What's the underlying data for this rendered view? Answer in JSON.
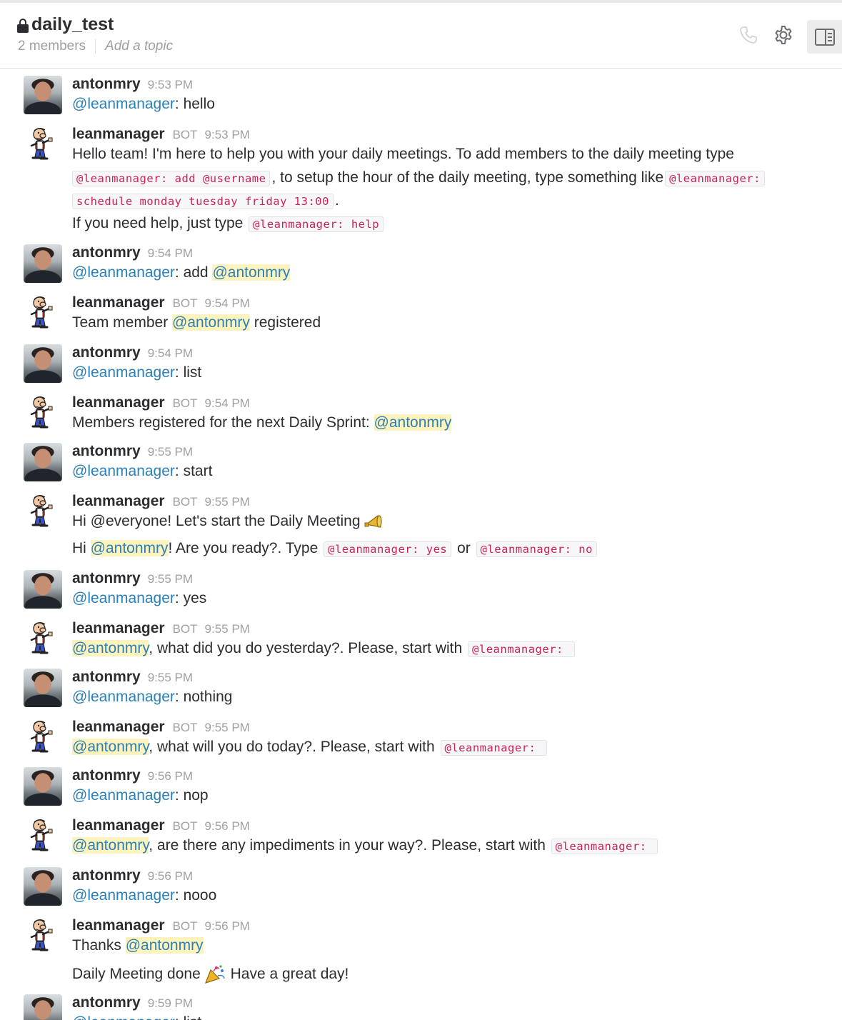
{
  "channel": {
    "name": "daily_test",
    "members": "2 members",
    "topic_placeholder": "Add a topic"
  },
  "header_icons": [
    "phone-icon",
    "gear-icon",
    "sidebar-toggle-icon"
  ],
  "bot_badge": "BOT",
  "messages": [
    {
      "user": "antonmry",
      "time": "9:53 PM",
      "mention": "@leanmanager",
      "text": ": hello"
    },
    {
      "user": "leanmanager",
      "time": "9:53 PM",
      "l1": "Hello team! I'm here to help you with your daily meetings. To add members to the daily meeting type",
      "c1": "@leanmanager: add @username",
      "l2": ", to setup the hour of the daily meeting, type something like",
      "c2a": "@leanmanager:",
      "c2b": "schedule monday tuesday friday 13:00",
      "dot": ".",
      "l3": "If you need help, just type",
      "c3": "@leanmanager: help"
    },
    {
      "user": "antonmry",
      "time": "9:54 PM",
      "mention": "@leanmanager",
      "text": ": add ",
      "mention2": "@antonmry"
    },
    {
      "user": "leanmanager",
      "time": "9:54 PM",
      "pre": "Team member ",
      "mention": "@antonmry",
      "post": " registered"
    },
    {
      "user": "antonmry",
      "time": "9:54 PM",
      "mention": "@leanmanager",
      "text": ": list"
    },
    {
      "user": "leanmanager",
      "time": "9:54 PM",
      "pre": "Members registered for the next Daily Sprint: ",
      "mention": "@antonmry"
    },
    {
      "user": "antonmry",
      "time": "9:55 PM",
      "mention": "@leanmanager",
      "text": ": start"
    },
    {
      "user": "leanmanager",
      "time": "9:55 PM",
      "l1": "Hi @everyone! Let's start the Daily Meeting",
      "emoji1": "loudspeaker-emoji",
      "l2pre": "Hi ",
      "mention": "@antonmry",
      "l2mid": "! Are you ready?. Type",
      "c1": "@leanmanager: yes",
      "or": "or",
      "c2": "@leanmanager: no"
    },
    {
      "user": "antonmry",
      "time": "9:55 PM",
      "mention": "@leanmanager",
      "text": ": yes"
    },
    {
      "user": "leanmanager",
      "time": "9:55 PM",
      "mention": "@antonmry",
      "post": ", what did you do yesterday?. Please, start with",
      "code": "@leanmanager: "
    },
    {
      "user": "antonmry",
      "time": "9:55 PM",
      "mention": "@leanmanager",
      "text": ": nothing"
    },
    {
      "user": "leanmanager",
      "time": "9:55 PM",
      "mention": "@antonmry",
      "post": ", what will you do today?. Please, start with",
      "code": "@leanmanager: "
    },
    {
      "user": "antonmry",
      "time": "9:56 PM",
      "mention": "@leanmanager",
      "text": ": nop"
    },
    {
      "user": "leanmanager",
      "time": "9:56 PM",
      "mention": "@antonmry",
      "post": ", are there any impediments in your way?. Please, start with",
      "code": "@leanmanager: "
    },
    {
      "user": "antonmry",
      "time": "9:56 PM",
      "mention": "@leanmanager",
      "text": ": nooo"
    },
    {
      "user": "leanmanager",
      "time": "9:56 PM",
      "pre": "Thanks ",
      "mention": "@antonmry",
      "l2pre": "Daily Meeting done",
      "emoji": "party-popper-emoji",
      "l2post": " Have a great day!"
    },
    {
      "user": "antonmry",
      "time": "9:59 PM",
      "mention": "@leanmanager",
      "text": ": list"
    }
  ]
}
